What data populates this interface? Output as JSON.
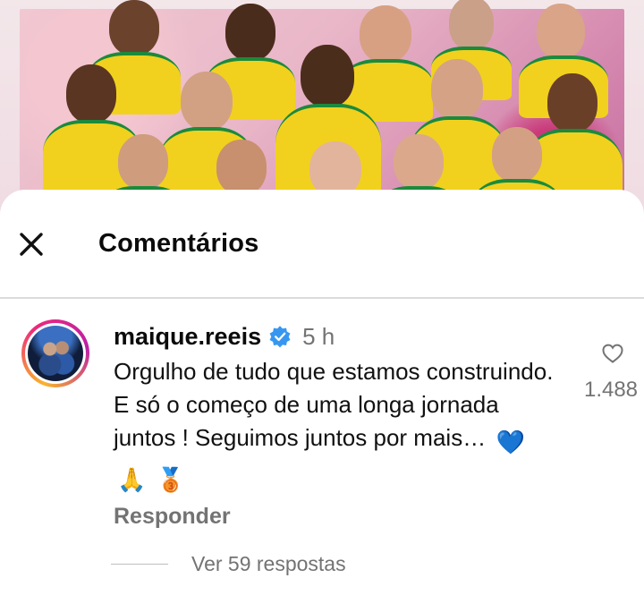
{
  "sheet": {
    "title": "Comentários"
  },
  "comment": {
    "username": "maique.reeis",
    "verified": true,
    "time": "5 h",
    "text": "Orgulho de tudo que estamos construindo. E só o começo de uma longa jornada juntos ! Seguimos juntos por mais…",
    "emojis": [
      "💙",
      "🙏",
      "🥉"
    ],
    "reply_label": "Responder",
    "like_count": "1.488",
    "view_replies": "Ver 59 respostas"
  },
  "colors": {
    "accent_blue": "#3797f0",
    "muted_text": "#737373",
    "jersey_yellow": "#f1d11e",
    "jersey_green": "#1b8a3c"
  },
  "icons": {
    "close": "close-icon",
    "verified": "verified-badge-icon",
    "like": "heart-outline-icon"
  }
}
